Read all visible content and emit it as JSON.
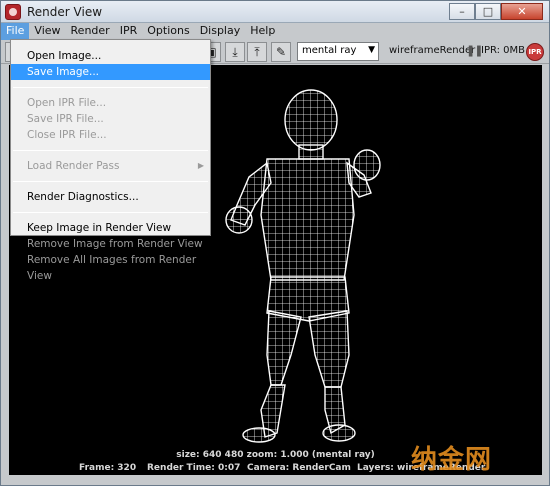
{
  "window": {
    "title": "Render View"
  },
  "menubar": {
    "items": [
      {
        "label": "File"
      },
      {
        "label": "View"
      },
      {
        "label": "Render"
      },
      {
        "label": "IPR"
      },
      {
        "label": "Options"
      },
      {
        "label": "Display"
      },
      {
        "label": "Help"
      }
    ]
  },
  "toolbar": {
    "renderer": "mental ray",
    "render_layer": "wireframeRender",
    "ipr_memory": "IPR: 0MB",
    "ipr_badge": "IPR"
  },
  "file_menu": {
    "items": [
      {
        "label": "Open Image...",
        "enabled": true
      },
      {
        "label": "Save Image...",
        "enabled": true,
        "highlighted": true
      },
      {
        "label": "Open IPR File...",
        "enabled": false
      },
      {
        "label": "Save IPR File...",
        "enabled": false
      },
      {
        "label": "Close IPR File...",
        "enabled": false
      },
      {
        "label": "Load Render Pass",
        "enabled": false,
        "submenu": true
      },
      {
        "label": "Render Diagnostics...",
        "enabled": true
      },
      {
        "label": "Keep Image in Render View",
        "enabled": true
      },
      {
        "label": "Remove Image from Render View",
        "enabled": false
      },
      {
        "label": "Remove All Images from Render View",
        "enabled": false
      }
    ]
  },
  "viewport": {
    "size_info": "size:  640  480 zoom: 1.000       (mental ray)",
    "frame": "Frame: 320",
    "render_time": "Render Time: 0:07",
    "camera": "Camera: RenderCam",
    "layers": "Layers: wireframeRender"
  },
  "watermark": {
    "text": "纳金网"
  },
  "colors": {
    "menu_highlight": "#3399ff",
    "viewport_bg": "#000000",
    "wireframe": "#ffffff"
  }
}
